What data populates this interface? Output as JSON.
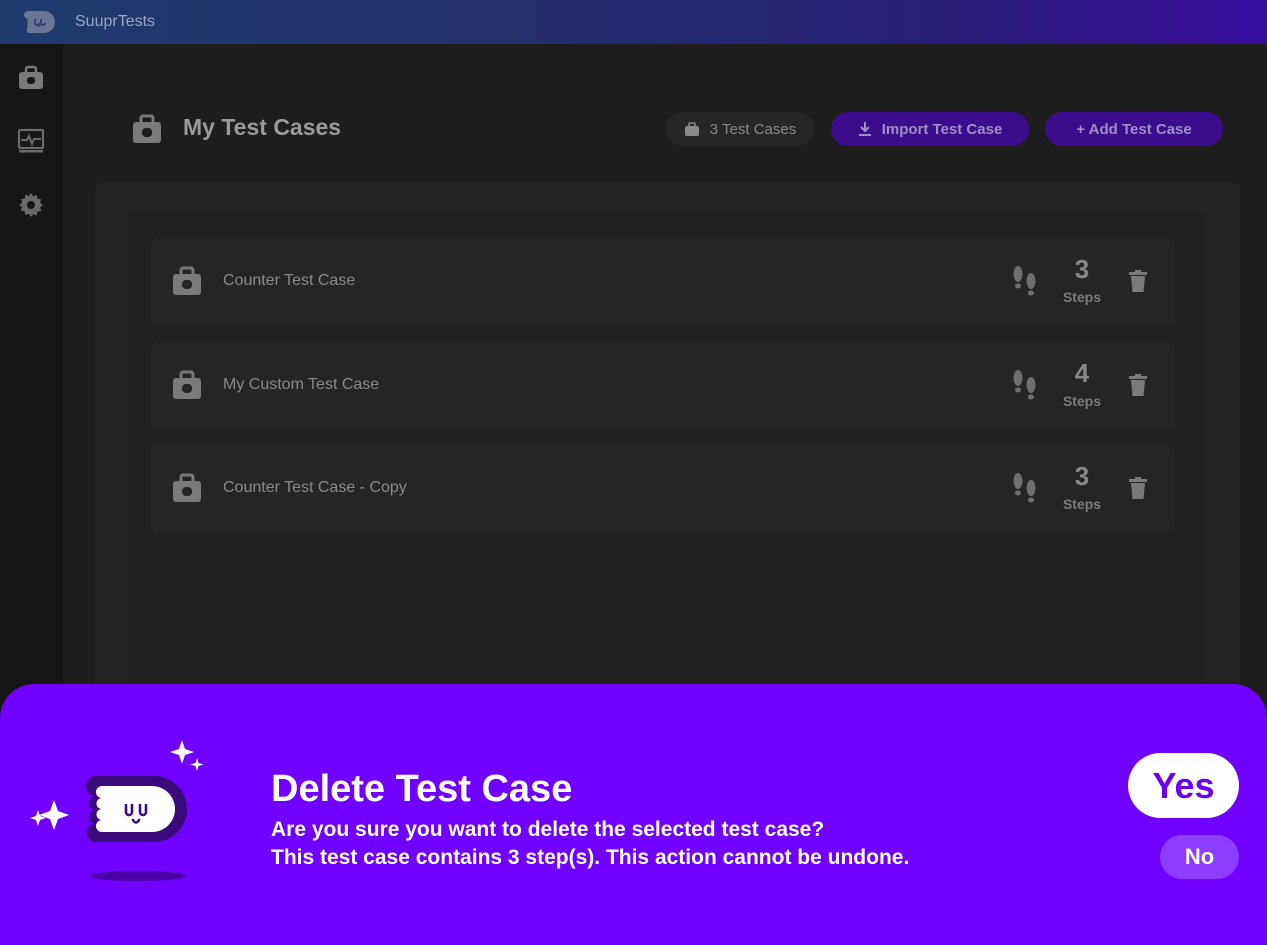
{
  "app": {
    "title": "SuuprTests"
  },
  "sidebar": {
    "items": [
      {
        "icon": "briefcase-icon"
      },
      {
        "icon": "monitor-heartbeat-icon"
      },
      {
        "icon": "gear-icon"
      }
    ]
  },
  "header": {
    "title": "My Test Cases",
    "count_label": "3 Test Cases",
    "import_label": "Import Test Case",
    "add_label": "+  Add Test Case"
  },
  "test_cases": [
    {
      "name": "Counter Test Case",
      "steps": "3",
      "steps_label": "Steps"
    },
    {
      "name": "My Custom Test Case",
      "steps": "4",
      "steps_label": "Steps"
    },
    {
      "name": "Counter Test Case - Copy",
      "steps": "3",
      "steps_label": "Steps"
    }
  ],
  "dialog": {
    "title": "Delete Test Case",
    "message_line1": "Are you sure you want to delete the selected test case?",
    "message_line2": "This test case contains 3 step(s). This action cannot be undone.",
    "yes_label": "Yes",
    "no_label": "No"
  },
  "colors": {
    "accent": "#7000ff",
    "button_purple": "#3c0c8c"
  }
}
